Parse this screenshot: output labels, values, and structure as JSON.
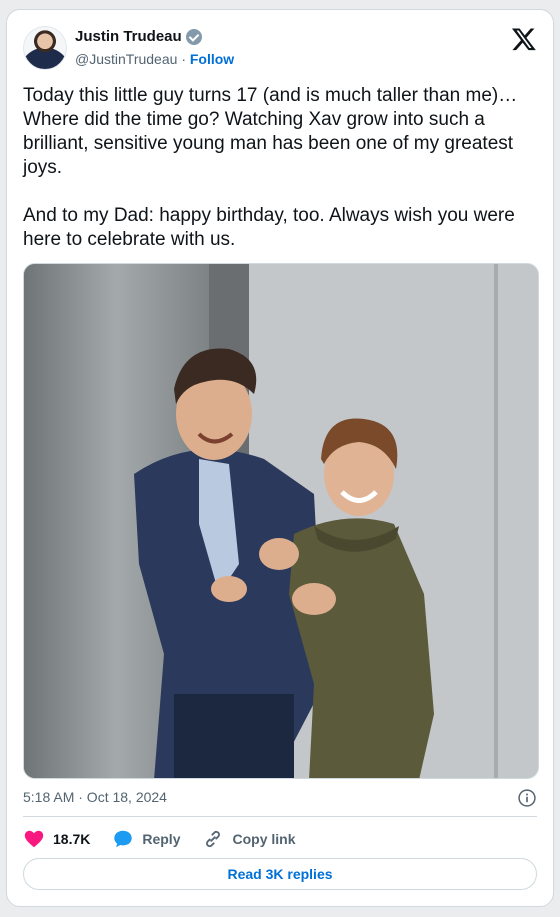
{
  "author": {
    "name": "Justin Trudeau",
    "handle": "@JustinTrudeau",
    "separator": "·",
    "follow_label": "Follow"
  },
  "tweet": {
    "text": "Today this little guy turns 17 (and is much taller than me)… Where did the time go? Watching Xav grow into such a brilliant, sensitive young man has been one of my greatest joys.\n\nAnd to my Dad: happy birthday, too. Always wish you were here to celebrate with us.",
    "timestamp": "5:18 AM · Oct 18, 2024"
  },
  "actions": {
    "likes_count": "18.7K",
    "reply_label": "Reply",
    "copy_link_label": "Copy link"
  },
  "footer": {
    "read_replies_label": "Read 3K replies"
  },
  "colors": {
    "link": "#006fd6",
    "like": "#f91880",
    "reply": "#1d9bf0",
    "secondary_text": "#536471",
    "verified_badge": "#829aab"
  },
  "icons": [
    "verified-badge-icon",
    "x-logo-icon",
    "info-icon",
    "heart-icon",
    "reply-bubble-icon",
    "link-icon"
  ]
}
